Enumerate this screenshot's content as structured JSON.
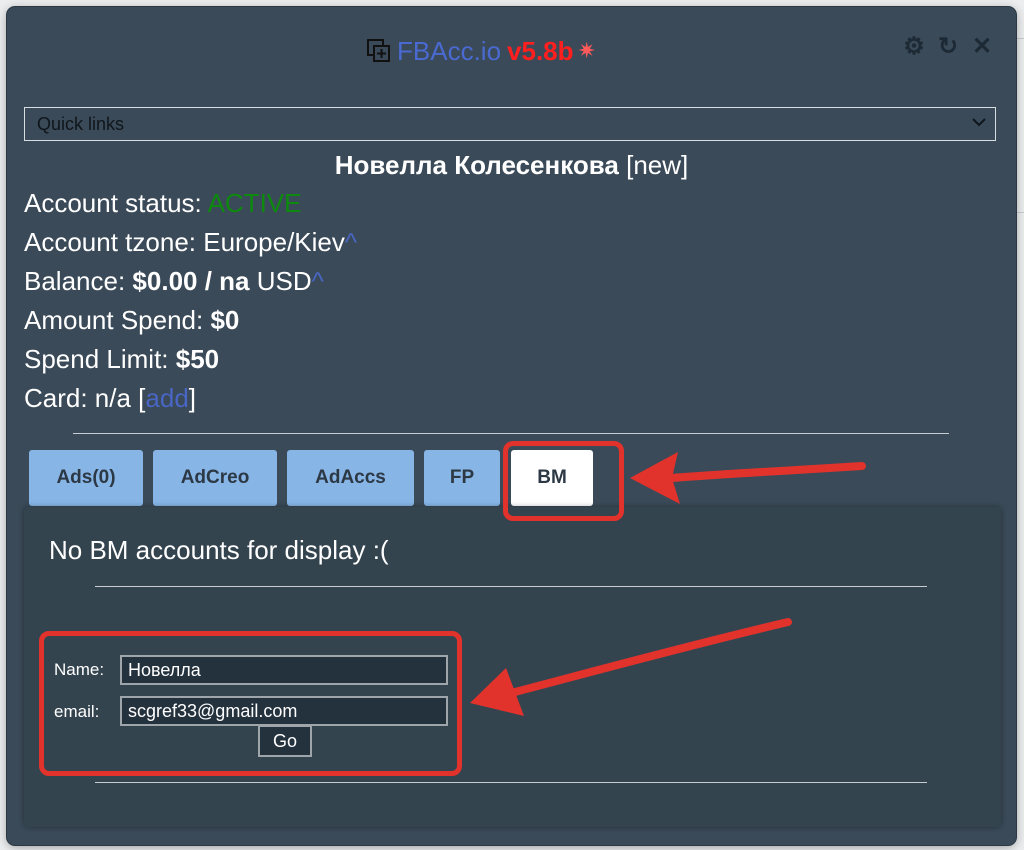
{
  "header": {
    "app_name": "FBAcc.io",
    "version": "v5.8b",
    "icons": [
      "add-window-icon",
      "sparkle-icon",
      "gear-icon",
      "refresh-icon",
      "close-icon"
    ]
  },
  "quick_links": {
    "selected": "Quick links"
  },
  "account": {
    "name": "Новелла Колесенкова",
    "name_tag": "[new]",
    "status_label": "Account status:",
    "status_value": "ACTIVE",
    "tzone_label": "Account tzone:",
    "tzone_value": "Europe/Kiev",
    "caret": "^",
    "balance_label": "Balance:",
    "balance_value": "$0.00 / na",
    "balance_currency": "USD",
    "spend_label": "Amount Spend:",
    "spend_value": "$0",
    "limit_label": "Spend Limit:",
    "limit_value": "$50",
    "card_label": "Card: n/a [",
    "card_link": "add",
    "card_close": "]"
  },
  "tabs": [
    {
      "label": "Ads(0)"
    },
    {
      "label": "AdCreo"
    },
    {
      "label": "AdAccs"
    },
    {
      "label": "FP"
    },
    {
      "label": "BM",
      "active": true
    }
  ],
  "bm": {
    "message": "No BM accounts for display :(",
    "name_label": "Name:",
    "name_value": "Новелла",
    "email_label": "email:",
    "email_value": "scgref33@gmail.com",
    "go_label": "Go"
  },
  "colors": {
    "panel_bg": "#3a4a58",
    "accent_link": "#4a66c4",
    "version_red": "#ff1f1f",
    "status_green": "#0d8a0d",
    "tab_blue": "#87b5e6",
    "annotation_red": "#e2322c"
  }
}
